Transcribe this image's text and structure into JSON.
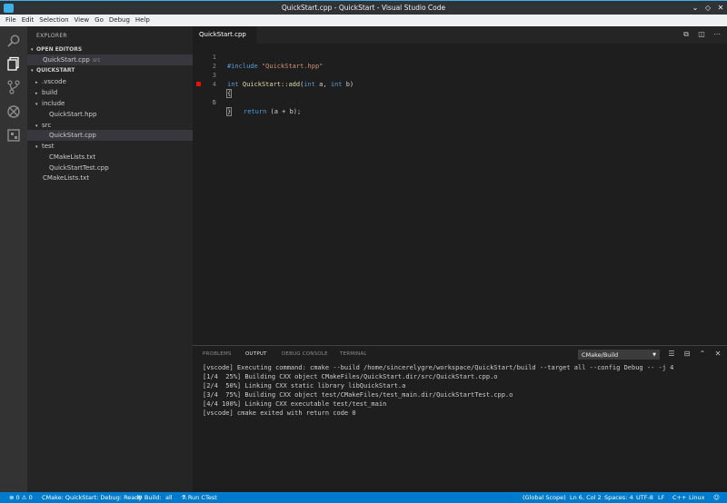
{
  "window": {
    "title": "QuickStart.cpp - QuickStart - Visual Studio Code",
    "controls": [
      "chevron-down-icon",
      "restore-icon",
      "close-icon"
    ]
  },
  "menu": [
    "File",
    "Edit",
    "Selection",
    "View",
    "Go",
    "Debug",
    "Help"
  ],
  "activity": [
    "search-icon",
    "files-icon",
    "git-icon",
    "debug-icon",
    "extensions-icon"
  ],
  "sidebar": {
    "title": "EXPLORER",
    "open_editors": {
      "label": "OPEN EDITORS",
      "items": [
        {
          "name": "QuickStart.cpp",
          "hint": "src"
        }
      ]
    },
    "workspace": {
      "label": "QUICKSTART",
      "tree": [
        {
          "name": ".vscode",
          "type": "folder-collapsed"
        },
        {
          "name": "build",
          "type": "folder-collapsed"
        },
        {
          "name": "include",
          "type": "folder-expanded"
        },
        {
          "name": "QuickStart.hpp",
          "type": "file"
        },
        {
          "name": "src",
          "type": "folder-expanded"
        },
        {
          "name": "QuickStart.cpp",
          "type": "file"
        },
        {
          "name": "test",
          "type": "folder-expanded"
        },
        {
          "name": "CMakeLists.txt",
          "type": "file"
        },
        {
          "name": "QuickStartTest.cpp",
          "type": "file"
        },
        {
          "name": "CMakeLists.txt",
          "type": "file"
        }
      ]
    }
  },
  "editor": {
    "tab_label": "QuickStart.cpp",
    "lines": [
      {
        "num": "1",
        "t1": "#include ",
        "t2": "\"QuickStart.hpp\""
      },
      {
        "num": "2"
      },
      {
        "num": "3",
        "kw1": "int",
        "fn": "QuickStart::add",
        "p1": "(",
        "kw2": "int",
        "p2": " a, ",
        "kw3": "int",
        "p3": " b)"
      },
      {
        "num": "4",
        "text": "{"
      },
      {
        "num": "5",
        "kw": "return",
        "text": " (a + b);"
      },
      {
        "num": "6",
        "text": "}"
      }
    ]
  },
  "panel": {
    "tabs": [
      "PROBLEMS",
      "OUTPUT",
      "DEBUG CONSOLE",
      "TERMINAL"
    ],
    "active_tab": "OUTPUT",
    "channel": "CMake/Build",
    "output": [
      "[vscode] Executing command: cmake --build /home/sincerelygre/workspace/QuickStart/build --target all --config Debug -- -j 4",
      "[1/4  25%] Building CXX object CMakeFiles/QuickStart.dir/src/QuickStart.cpp.o",
      "[2/4  50%] Linking CXX static library libQuickStart.a",
      "[3/4  75%] Building CXX object test/CMakeFiles/test_main.dir/QuickStartTest.cpp.o",
      "[4/4 100%] Linking CXX executable test/test_main",
      "[vscode] cmake exited with return code 0"
    ]
  },
  "status": {
    "errors": "0",
    "warnings": "0",
    "cmake": "CMake: QuickStart: Debug: Ready",
    "build_label": "Build:",
    "build_target": "all",
    "run_ctest": "Run CTest",
    "scope": "(Global Scope)",
    "position": "Ln 6, Col 2",
    "spaces": "Spaces: 4",
    "encoding": "UTF-8",
    "eol": "LF",
    "language": "C++",
    "platform": "Linux"
  },
  "colors": {
    "statusbar": "#007acc",
    "activitybar": "#333333",
    "sidebar": "#252526",
    "editor": "#1e1e1e",
    "breakpoint": "#e51400"
  }
}
